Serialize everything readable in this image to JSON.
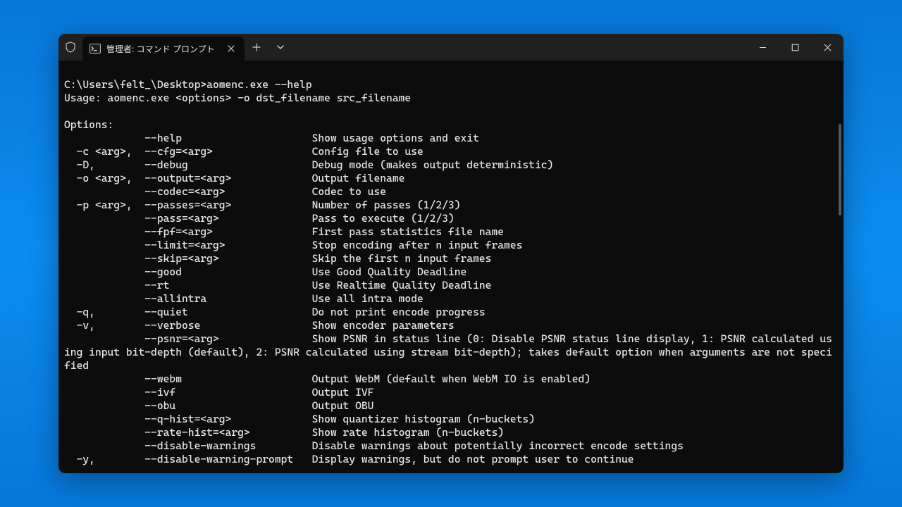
{
  "window": {
    "tab_title": "管理者: コマンド プロンプト"
  },
  "prompt": "C:\\Users\\felt_\\Desktop>",
  "command": "aomenc.exe --help",
  "usage": "Usage: aomenc.exe <options> -o dst_filename src_filename",
  "options_header": "Options:",
  "options": [
    {
      "short": "",
      "long": "--help",
      "desc": "Show usage options and exit"
    },
    {
      "short": "-c <arg>,",
      "long": "--cfg=<arg>",
      "desc": "Config file to use"
    },
    {
      "short": "-D,",
      "long": "--debug",
      "desc": "Debug mode (makes output deterministic)"
    },
    {
      "short": "-o <arg>,",
      "long": "--output=<arg>",
      "desc": "Output filename"
    },
    {
      "short": "",
      "long": "--codec=<arg>",
      "desc": "Codec to use"
    },
    {
      "short": "-p <arg>,",
      "long": "--passes=<arg>",
      "desc": "Number of passes (1/2/3)"
    },
    {
      "short": "",
      "long": "--pass=<arg>",
      "desc": "Pass to execute (1/2/3)"
    },
    {
      "short": "",
      "long": "--fpf=<arg>",
      "desc": "First pass statistics file name"
    },
    {
      "short": "",
      "long": "--limit=<arg>",
      "desc": "Stop encoding after n input frames"
    },
    {
      "short": "",
      "long": "--skip=<arg>",
      "desc": "Skip the first n input frames"
    },
    {
      "short": "",
      "long": "--good",
      "desc": "Use Good Quality Deadline"
    },
    {
      "short": "",
      "long": "--rt",
      "desc": "Use Realtime Quality Deadline"
    },
    {
      "short": "",
      "long": "--allintra",
      "desc": "Use all intra mode"
    },
    {
      "short": "-q,",
      "long": "--quiet",
      "desc": "Do not print encode progress"
    },
    {
      "short": "-v,",
      "long": "--verbose",
      "desc": "Show encoder parameters"
    },
    {
      "short": "",
      "long": "--psnr=<arg>",
      "desc": "Show PSNR in status line (0: Disable PSNR status line display, 1: PSNR calculated using input bit-depth (default), 2: PSNR calculated using stream bit-depth); takes default option when arguments are not specified"
    },
    {
      "short": "",
      "long": "--webm",
      "desc": "Output WebM (default when WebM IO is enabled)"
    },
    {
      "short": "",
      "long": "--ivf",
      "desc": "Output IVF"
    },
    {
      "short": "",
      "long": "--obu",
      "desc": "Output OBU"
    },
    {
      "short": "",
      "long": "--q-hist=<arg>",
      "desc": "Show quantizer histogram (n-buckets)"
    },
    {
      "short": "",
      "long": "--rate-hist=<arg>",
      "desc": "Show rate histogram (n-buckets)"
    },
    {
      "short": "",
      "long": "--disable-warnings",
      "desc": "Disable warnings about potentially incorrect encode settings"
    },
    {
      "short": "-y,",
      "long": "--disable-warning-prompt",
      "desc": "Display warnings, but do not prompt user to continue"
    }
  ]
}
